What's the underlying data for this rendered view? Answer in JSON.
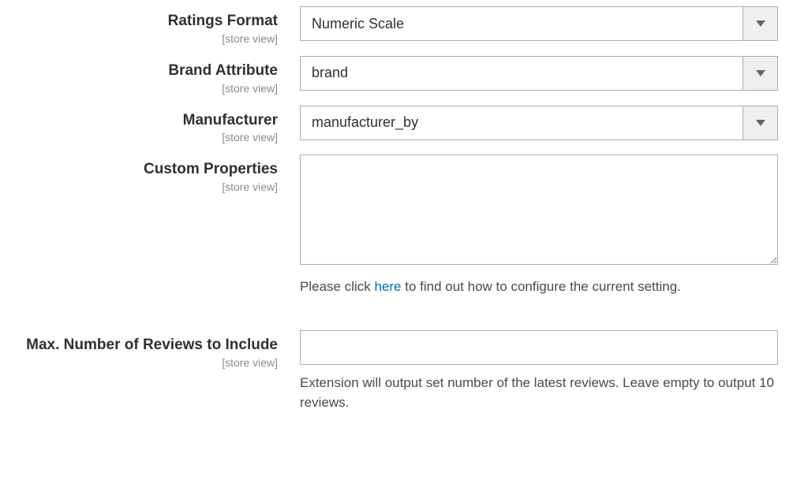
{
  "scope_label": "[store view]",
  "fields": {
    "ratings_format": {
      "label": "Ratings Format",
      "value": "Numeric Scale"
    },
    "brand_attribute": {
      "label": "Brand Attribute",
      "value": "brand"
    },
    "manufacturer": {
      "label": "Manufacturer",
      "value": "manufacturer_by"
    },
    "custom_properties": {
      "label": "Custom Properties",
      "value": "",
      "hint_pre": "Please click ",
      "hint_link": "here",
      "hint_post": " to find out how to configure the current setting."
    },
    "max_reviews": {
      "label": "Max. Number of Reviews to Include",
      "value": "",
      "hint": "Extension will output set number of the latest reviews. Leave empty to output 10 reviews."
    }
  }
}
